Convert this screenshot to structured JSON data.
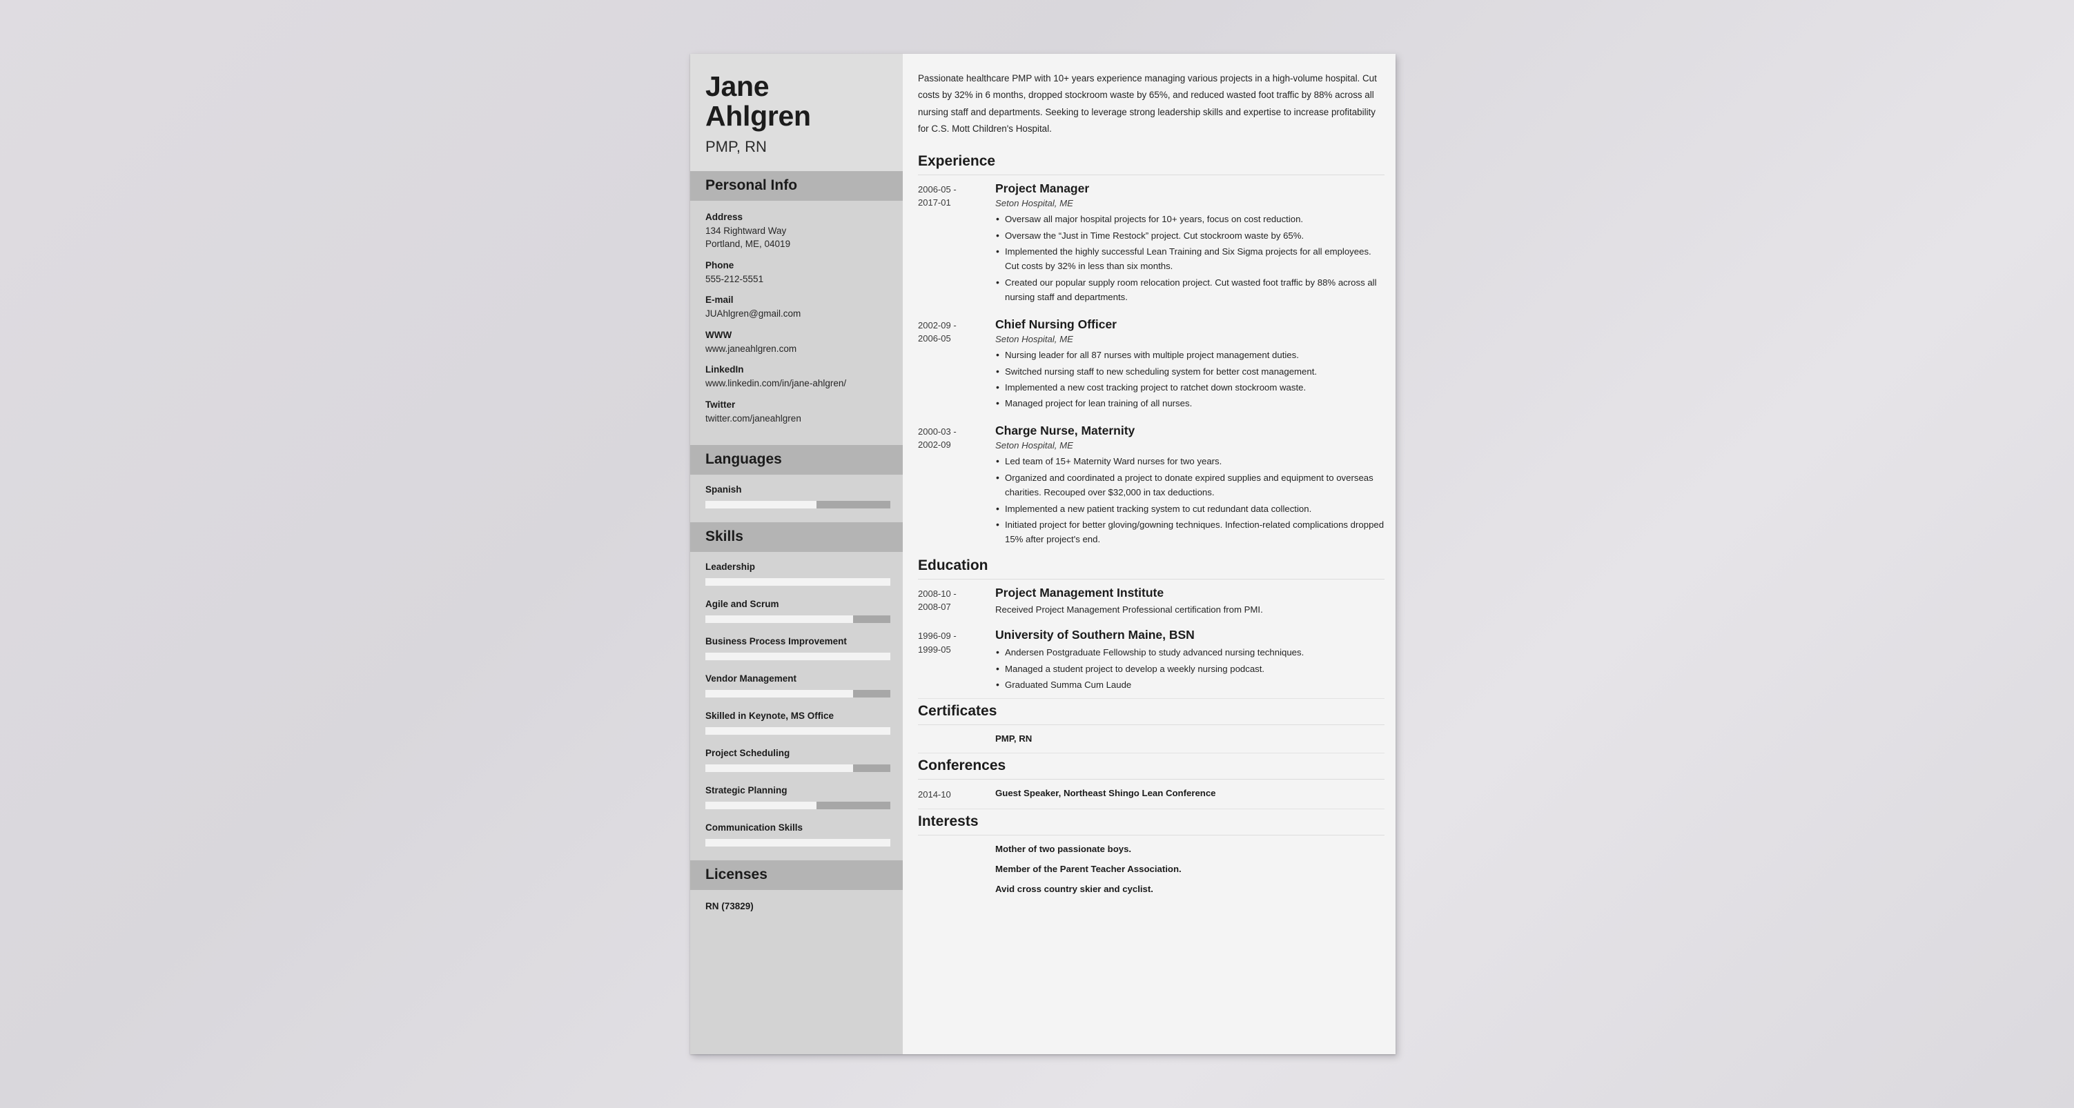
{
  "document": {
    "accent_header_bg": "#b4b4b4",
    "sidebar_bg": "#d3d3d3",
    "page_bg": "#f4f4f4"
  },
  "sidebar": {
    "name_first": "Jane",
    "name_last": "Ahlgren",
    "job_title": "PMP, RN",
    "personal_info": {
      "heading": "Personal Info",
      "items": [
        {
          "label": "Address",
          "value_line1": "134 Rightward Way",
          "value_line2": "Portland, ME, 04019"
        },
        {
          "label": "Phone",
          "value_line1": "555-212-5551"
        },
        {
          "label": "E-mail",
          "value_line1": "JUAhlgren@gmail.com"
        },
        {
          "label": "WWW",
          "value_line1": "www.janeahlgren.com"
        },
        {
          "label": "LinkedIn",
          "value_line1": "www.linkedin.com/in/jane-ahlgren/"
        },
        {
          "label": "Twitter",
          "value_line1": "twitter.com/janeahlgren"
        }
      ]
    },
    "languages": {
      "heading": "Languages",
      "items": [
        {
          "label": "Spanish",
          "level_percent": 60
        }
      ]
    },
    "skills": {
      "heading": "Skills",
      "items": [
        {
          "label": "Leadership",
          "level_percent": 100
        },
        {
          "label": "Agile and Scrum",
          "level_percent": 80
        },
        {
          "label": "Business Process Improvement",
          "level_percent": 100
        },
        {
          "label": "Vendor Management",
          "level_percent": 80
        },
        {
          "label": "Skilled in Keynote, MS Office",
          "level_percent": 100
        },
        {
          "label": "Project Scheduling",
          "level_percent": 80
        },
        {
          "label": "Strategic Planning",
          "level_percent": 60
        },
        {
          "label": "Communication Skills",
          "level_percent": 100
        }
      ]
    },
    "licenses": {
      "heading": "Licenses",
      "items": [
        "RN (73829)"
      ]
    }
  },
  "main": {
    "summary": "Passionate healthcare PMP with 10+ years experience managing various projects in a high-volume hospital. Cut costs by 32% in 6 months, dropped stockroom waste by 65%, and reduced wasted foot traffic by 88% across all nursing staff and departments. Seeking to leverage strong leadership skills and expertise to increase profitability for C.S. Mott Children's Hospital.",
    "experience": {
      "heading": "Experience",
      "entries": [
        {
          "date_start": "2006-05 -",
          "date_end": "2017-01",
          "title": "Project Manager",
          "organization": "Seton Hospital, ME",
          "bullets": [
            "Oversaw all major hospital projects for 10+ years, focus on cost reduction.",
            "Oversaw the “Just in Time Restock” project. Cut stockroom waste by 65%.",
            "Implemented the highly successful Lean Training and Six Sigma projects for all employees. Cut costs by 32% in less than six months.",
            "Created our popular supply room relocation project. Cut wasted foot traffic by 88% across all nursing staff and departments."
          ]
        },
        {
          "date_start": "2002-09 -",
          "date_end": "2006-05",
          "title": "Chief Nursing Officer",
          "organization": "Seton Hospital, ME",
          "bullets": [
            "Nursing leader for all 87 nurses with multiple project management duties.",
            "Switched nursing staff to new scheduling system for better cost management.",
            "Implemented a new cost tracking project to ratchet down stockroom waste.",
            "Managed project for lean training of all nurses."
          ]
        },
        {
          "date_start": "2000-03 -",
          "date_end": "2002-09",
          "title": "Charge Nurse, Maternity",
          "organization": "Seton Hospital, ME",
          "bullets": [
            "Led team of 15+ Maternity Ward nurses for two years.",
            "Organized and coordinated a project to donate expired supplies and equipment to overseas charities. Recouped over $32,000 in tax deductions.",
            "Implemented a new patient tracking system to cut redundant data collection.",
            "Initiated project for better gloving/gowning techniques. Infection-related complications dropped 15% after project's end."
          ]
        }
      ]
    },
    "education": {
      "heading": "Education",
      "entries": [
        {
          "date_start": "2008-10 -",
          "date_end": "2008-07",
          "title": "Project Management Institute",
          "note": "Received Project Management Professional certification from PMI.",
          "bullets": []
        },
        {
          "date_start": "1996-09 -",
          "date_end": "1999-05",
          "title": "University of Southern Maine, BSN",
          "note": "",
          "bullets": [
            "Andersen Postgraduate Fellowship to study advanced nursing techniques.",
            "Managed a student project to develop a weekly nursing podcast.",
            "Graduated Summa Cum Laude"
          ]
        }
      ]
    },
    "certificates": {
      "heading": "Certificates",
      "entries": [
        {
          "date": "",
          "text": "PMP, RN"
        }
      ]
    },
    "conferences": {
      "heading": "Conferences",
      "entries": [
        {
          "date": "2014-10",
          "text": "Guest Speaker, Northeast Shingo Lean Conference"
        }
      ]
    },
    "interests": {
      "heading": "Interests",
      "items": [
        "Mother of two passionate boys.",
        "Member of the Parent Teacher Association.",
        "Avid cross country skier and cyclist."
      ]
    }
  }
}
